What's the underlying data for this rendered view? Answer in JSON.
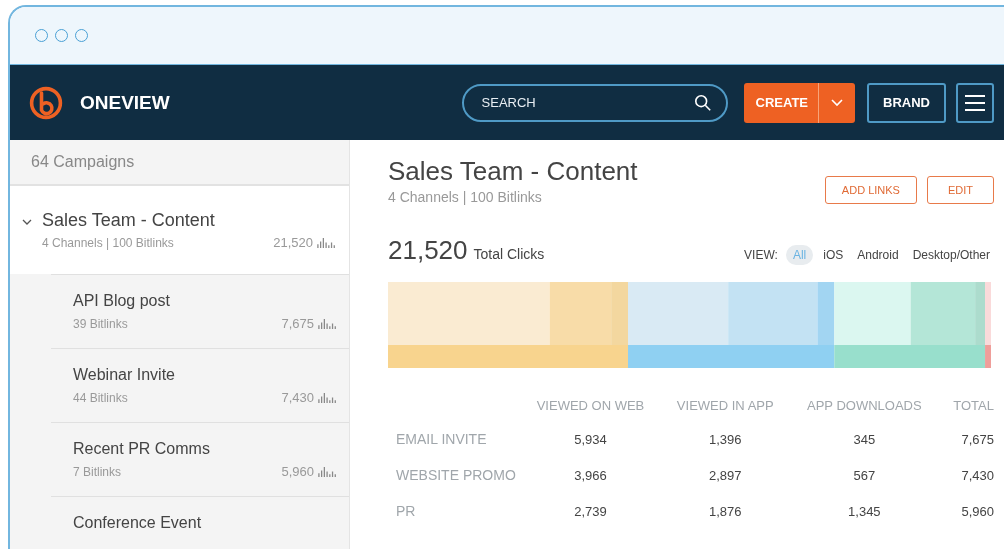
{
  "topbar": {
    "brand": "ONEVIEW",
    "search": {
      "placeholder": "SEARCH"
    },
    "create_button": "CREATE",
    "brand_button": "BRAND"
  },
  "sidebar": {
    "header": "64 Campaigns",
    "campaigns": [
      {
        "name": "Sales Team - Content",
        "meta": "4 Channels | 100 Bitlinks",
        "clicks": "21,520",
        "expanded": true,
        "children": [
          {
            "name": "API Blog post",
            "meta": "39 Bitlinks",
            "clicks": "7,675"
          },
          {
            "name": "Webinar Invite",
            "meta": "44 Bitlinks",
            "clicks": "7,430"
          },
          {
            "name": "Recent PR Comms",
            "meta": "7 Bitlinks",
            "clicks": "5,960"
          },
          {
            "name": "Conference Event"
          }
        ]
      }
    ]
  },
  "main": {
    "title": "Sales Team - Content",
    "subtitle": "4 Channels | 100 Bitlinks",
    "buttons": [
      "ADD LINKS",
      "EDIT"
    ],
    "total": "21,520",
    "total_label": "Total Clicks",
    "view_label": "VIEW:",
    "view_options": [
      {
        "label": "All",
        "selected": true
      },
      {
        "label": "iOS",
        "selected": false
      },
      {
        "label": "Android",
        "selected": false
      },
      {
        "label": "Desktop/Other",
        "selected": false
      }
    ],
    "table": {
      "columns": [
        "VIEWED ON WEB",
        "VIEWED IN APP",
        "APP DOWNLOADS",
        "TOTAL"
      ],
      "rows": [
        {
          "label": "EMAIL INVITE",
          "values": [
            "5,934",
            "1,396",
            "345",
            "7,675"
          ]
        },
        {
          "label": "WEBSITE PROMO",
          "values": [
            "3,966",
            "2,897",
            "567",
            "7,430"
          ]
        },
        {
          "label": "PR",
          "values": [
            "2,739",
            "1,876",
            "1,345",
            "5,960"
          ]
        }
      ]
    }
  }
}
